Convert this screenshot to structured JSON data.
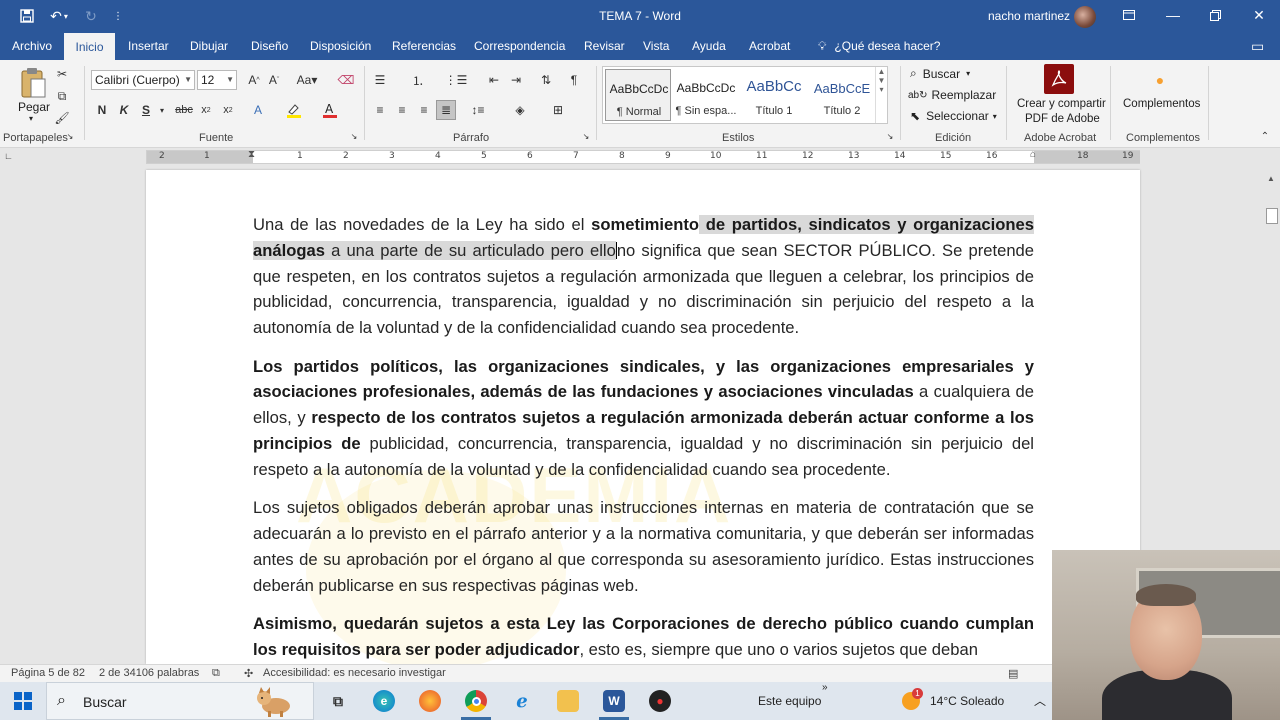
{
  "titlebar": {
    "doc_title": "TEMA 7  -  Word",
    "user_name": "nacho martinez",
    "save_icon": "save-icon",
    "undo_icon": "undo-icon",
    "redo_icon": "redo-icon"
  },
  "tabs": [
    "Archivo",
    "Inicio",
    "Insertar",
    "Dibujar",
    "Diseño",
    "Disposición",
    "Referencias",
    "Correspondencia",
    "Revisar",
    "Vista",
    "Ayuda",
    "Acrobat"
  ],
  "tell_me": "¿Qué desea hacer?",
  "active_tab": "Inicio",
  "ribbon": {
    "clipboard": {
      "paste_label": "Pegar",
      "group_label": "Portapapeles"
    },
    "font": {
      "name": "Calibri (Cuerpo)",
      "size": "12",
      "group_label": "Fuente"
    },
    "paragraph": {
      "group_label": "Párrafo"
    },
    "styles": {
      "group_label": "Estilos",
      "items": [
        {
          "sample": "AaBbCcDc",
          "name": "¶ Normal"
        },
        {
          "sample": "AaBbCcDc",
          "name": "¶ Sin espa..."
        },
        {
          "sample": "AaBbCc",
          "name": "Título 1"
        },
        {
          "sample": "AaBbCcE",
          "name": "Título 2"
        }
      ]
    },
    "editing": {
      "find": "Buscar",
      "replace": "Reemplazar",
      "select": "Seleccionar",
      "group_label": "Edición"
    },
    "acrobat": {
      "label_line1": "Crear y compartir",
      "label_line2": "PDF de Adobe",
      "group_label": "Adobe Acrobat"
    },
    "addins": {
      "label": "Complementos",
      "group_label": "Complementos"
    }
  },
  "ruler": {
    "numbers": [
      "2",
      "1",
      "1",
      "2",
      "3",
      "4",
      "5",
      "6",
      "7",
      "8",
      "9",
      "10",
      "11",
      "12",
      "13",
      "14",
      "15",
      "16",
      "17",
      "18",
      "19"
    ]
  },
  "document": {
    "p1_a": "Una de las novedades de la Ley ha sido el ",
    "p1_b": "sometimiento",
    "p1_c": " de partidos, sindicatos y organizaciones análogas",
    "p1_d": " a una parte de su articulado pero ello",
    "p1_e": "no significa que sean SECTOR PÚBLICO. Se pretende que respeten, en los contratos sujetos a regulación armonizada que lleguen a celebrar, los principios de publicidad, concurrencia, transparencia, igualdad y no discriminación sin perjuicio del respeto a la autonomía de la voluntad y de la confidencialidad cuando sea procedente.",
    "p2_a": "Los partidos políticos, las organizaciones sindicales, y las organizaciones empresariales y asociaciones profesionales, además de las fundaciones y asociaciones vinculadas",
    "p2_b": " a cualquiera de ellos, y ",
    "p2_c": "respecto de los contratos sujetos a regulación armonizada deberán actuar conforme a los principios de",
    "p2_d": " publicidad, concurrencia, transparencia, igualdad y no discriminación sin perjuicio del respeto a la autonomía de la voluntad y de la confidencialidad cuando sea procedente.",
    "p3": "Los sujetos obligados deberán aprobar unas instrucciones internas en materia de contratación que se adecuarán a lo previsto en el párrafo anterior y a la normativa comunitaria, y que deberán ser informadas antes de su aprobación por el órgano al que corresponda su asesoramiento jurídico. Estas instrucciones deberán publicarse en sus respectivas páginas web.",
    "p4_a": "Asimismo, quedarán sujetos a esta Ley las Corporaciones de derecho público cuando cumplan los requisitos para ser poder adjudicador",
    "p4_b": ", esto es, siempre que uno o varios sujetos que deban"
  },
  "statusbar": {
    "page": "Página 5 de 82",
    "words": "2 de 34106 palabras",
    "accessibility": "Accesibilidad: es necesario investigar"
  },
  "taskbar": {
    "search_label": "Buscar",
    "this_pc": "Este equipo",
    "weather": "14°C  Soleado",
    "notification_count": "1"
  },
  "colors": {
    "word_blue": "#2b579a",
    "ribbon_bg": "#f3f3f3",
    "highlight": "#d9d9d9",
    "font_color_red": "#e03030"
  }
}
